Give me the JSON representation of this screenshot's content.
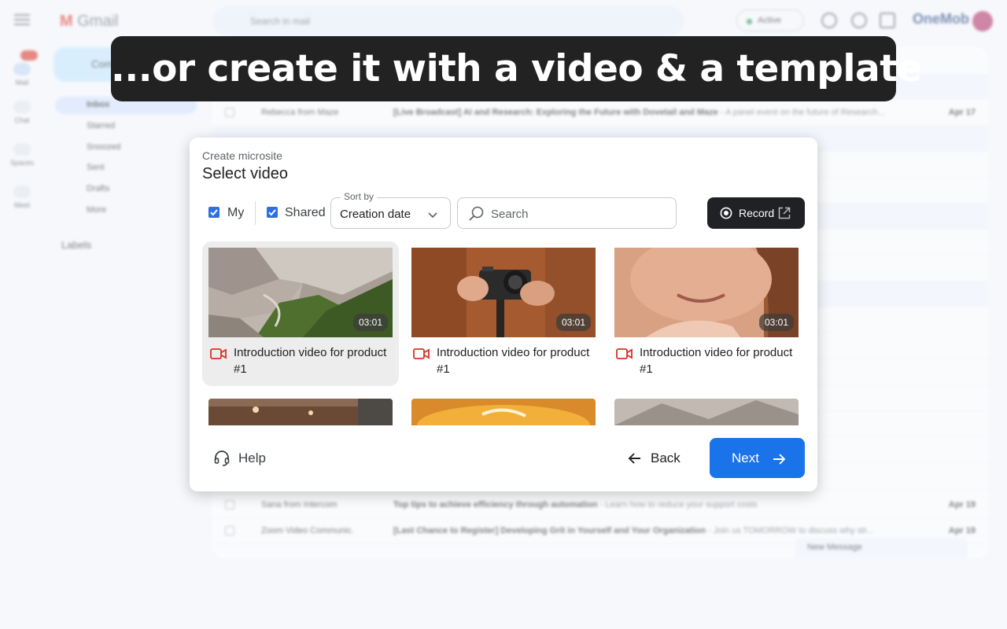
{
  "background": {
    "app_name": "Gmail",
    "search_placeholder": "Search in mail",
    "status": "Active",
    "brand": "OneMob",
    "compose": "Compose",
    "nav": [
      "Inbox",
      "Starred",
      "Snoozed",
      "Sent",
      "Drafts",
      "More"
    ],
    "labels_heading": "Labels",
    "rail": [
      "Mail",
      "Chat",
      "Spaces",
      "Meet"
    ],
    "rows": [
      {
        "sender": "Rebecca from Maze",
        "subject": "[Live Broadcast] AI and Research: Exploring the Future with Dovetail and Maze",
        "snippet": " - A panel event on the future of Research...",
        "date": "Apr 17"
      },
      {
        "sender": "Sana from Intercom",
        "subject": "Top tips to achieve efficiency through automation",
        "snippet": " - Learn how to reduce your support costs",
        "date": "Apr 19"
      },
      {
        "sender": "Zoom Video Communic.",
        "subject": "[Last Chance to Register] Developing Grit in Yourself and Your Organization",
        "snippet": " - Join us TOMORROW to discuss why str...",
        "date": "Apr 19"
      }
    ],
    "new_message": "New Message"
  },
  "caption": "...or create it with a video & a template",
  "dialog": {
    "eyebrow": "Create microsite",
    "title": "Select video",
    "filters": {
      "my_label": "My",
      "my_checked": true,
      "shared_label": "Shared",
      "shared_checked": true
    },
    "sort": {
      "label": "Sort by",
      "value": "Creation date"
    },
    "search": {
      "placeholder": "Search",
      "value": ""
    },
    "record_label": "Record",
    "videos": [
      {
        "title": "Introduction video for product #1",
        "duration": "03:01",
        "selected": true,
        "thumb": "mountain-valley"
      },
      {
        "title": "Introduction video for product #1",
        "duration": "03:01",
        "selected": false,
        "thumb": "camera-hands"
      },
      {
        "title": "Introduction video for product #1",
        "duration": "03:01",
        "selected": false,
        "thumb": "smiling-woman"
      }
    ],
    "help_label": "Help",
    "back_label": "Back",
    "next_label": "Next",
    "colors": {
      "accent": "#1a73e8",
      "record_bg": "#202124",
      "video_icon": "#d93025"
    }
  }
}
